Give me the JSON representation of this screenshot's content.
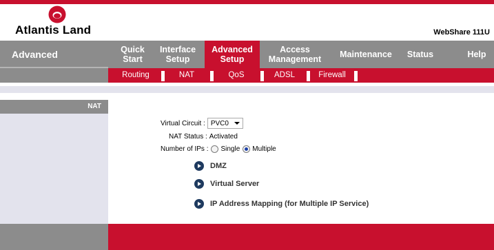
{
  "brand": {
    "logo_text": "Atlantis Land",
    "product": "WebShare 111U"
  },
  "nav": {
    "section_title": "Advanced",
    "tabs": [
      {
        "line1": "Quick",
        "line2": "Start"
      },
      {
        "line1": "Interface",
        "line2": "Setup"
      },
      {
        "line1": "Advanced",
        "line2": "Setup"
      },
      {
        "line1": "Access",
        "line2": "Management"
      },
      {
        "line1": "Maintenance",
        "line2": ""
      },
      {
        "line1": "Status",
        "line2": ""
      },
      {
        "line1": "Help",
        "line2": ""
      }
    ],
    "active_tab": "Advanced Setup"
  },
  "subnav": {
    "items": [
      "Routing",
      "NAT",
      "QoS",
      "ADSL",
      "Firewall"
    ]
  },
  "sidebar": {
    "header": "NAT"
  },
  "form": {
    "virtual_circuit_label": "Virtual Circuit :",
    "virtual_circuit_value": "PVC0",
    "nat_status_label": "NAT Status :",
    "nat_status_value": "Activated",
    "num_ips_label": "Number of IPs :",
    "option_single": "Single",
    "option_multiple": "Multiple",
    "selected_option": "Multiple"
  },
  "links": {
    "dmz": "DMZ",
    "virtual_server": "Virtual Server",
    "ip_mapping": "IP Address Mapping (for Multiple IP Service)"
  },
  "colors": {
    "brand_red": "#c8102e",
    "nav_gray": "#8c8c8c",
    "panel_lavender": "#e3e3ed"
  }
}
